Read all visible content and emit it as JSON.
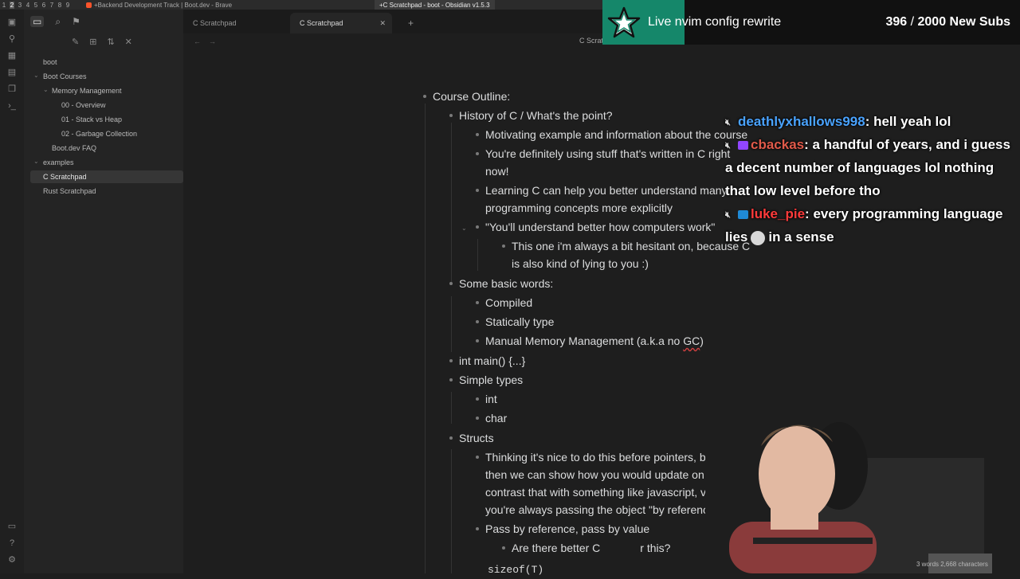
{
  "os_bar": {
    "workspaces": [
      "1",
      "2",
      "3",
      "4",
      "5",
      "6",
      "7",
      "8",
      "9"
    ],
    "active_workspace_index": 1,
    "window_brave": "+Backend Development Track | Boot.dev - Brave",
    "window_obsidian": "+C Scratchpad - boot - Obsidian v1.5.3"
  },
  "ribbon_icons": [
    "layout-icon",
    "graph-icon",
    "canvas-icon",
    "calendar-icon",
    "template-icon",
    "terminal-icon",
    "vault-icon",
    "help-icon",
    "settings-icon"
  ],
  "sidebar": {
    "top_icons": [
      "files-icon",
      "search-icon",
      "bookmark-icon"
    ],
    "actions": [
      "new-note-icon",
      "new-folder-icon",
      "sort-icon",
      "collapse-icon"
    ],
    "vault_name": "boot",
    "tree": [
      {
        "label": "Boot Courses",
        "level": 0,
        "type": "folder",
        "expanded": true
      },
      {
        "label": "Memory Management",
        "level": 1,
        "type": "folder",
        "expanded": true
      },
      {
        "label": "00 - Overview",
        "level": 2,
        "type": "file"
      },
      {
        "label": "01 - Stack vs Heap",
        "level": 2,
        "type": "file"
      },
      {
        "label": "02 - Garbage Collection",
        "level": 2,
        "type": "file"
      },
      {
        "label": "Boot.dev FAQ",
        "level": 1,
        "type": "file"
      },
      {
        "label": "examples",
        "level": 0,
        "type": "folder",
        "expanded": true
      },
      {
        "label": "C Scratchpad",
        "level": 1,
        "type": "file",
        "active": true
      },
      {
        "label": "Rust Scratchpad",
        "level": 1,
        "type": "file"
      }
    ]
  },
  "tabs": [
    {
      "label": "C Scratchpad",
      "active": false
    },
    {
      "label": "C Scratchpad",
      "active": true
    }
  ],
  "view_title": "C Scratchpad",
  "outline": {
    "course_outline": "Course Outline:",
    "history": "History of C / What's the point?",
    "motivating": "Motivating example and information about the course",
    "definitely_1": "You're definitely using stuff that's written in C right",
    "definitely_2": "now!",
    "learning_1": "Learning C can help you better understand many",
    "learning_2": "programming concepts more explicitly",
    "understand": "\"You'll understand better how computers work\"",
    "hesitant_1": "This one i'm always a bit hesitant on, because C",
    "hesitant_2": "is also kind of lying to you :)",
    "basic_words": "Some basic words:",
    "compiled": "Compiled",
    "statically": "Statically type",
    "manual_mem_a": "Manual Memory Management (a.k.a no ",
    "manual_mem_b": "GC",
    "manual_mem_c": ")",
    "int_main": "int main() {...}",
    "simple_types": "Simple types",
    "int": "int",
    "char": "char",
    "structs": "Structs",
    "thinking_1": "Thinking it's nice to do this before pointers, bo",
    "thinking_2": "then we can show how you would update on",
    "thinking_3": "contrast that with something like javascript, v",
    "thinking_4": "you're always passing the object \"by reference",
    "pass_by": "Pass by reference, pass by value",
    "better_c": "Are there better C",
    "better_c_tail": "r this?",
    "sizeof": "sizeof(T)"
  },
  "stream_banner": {
    "title": "Live nvim config rewrite",
    "sub_count": "396",
    "sub_sep": " / ",
    "sub_goal": "2000 New Subs",
    "accent": "#15876a"
  },
  "chat": [
    {
      "user": "deathlyxhallows998",
      "color": "#4aa3ff",
      "text": "hell yeah lol"
    },
    {
      "user": "cbackas",
      "color": "#e05a4a",
      "text": "a handful of years, and i guess a decent number of languages lol nothing that low level before tho"
    },
    {
      "user": "luke_pie",
      "color": "#ff3b3b",
      "text": "every programming language lies",
      "text_tail": "in a sense"
    }
  ],
  "status_bar": "3 words 2,668 characters"
}
